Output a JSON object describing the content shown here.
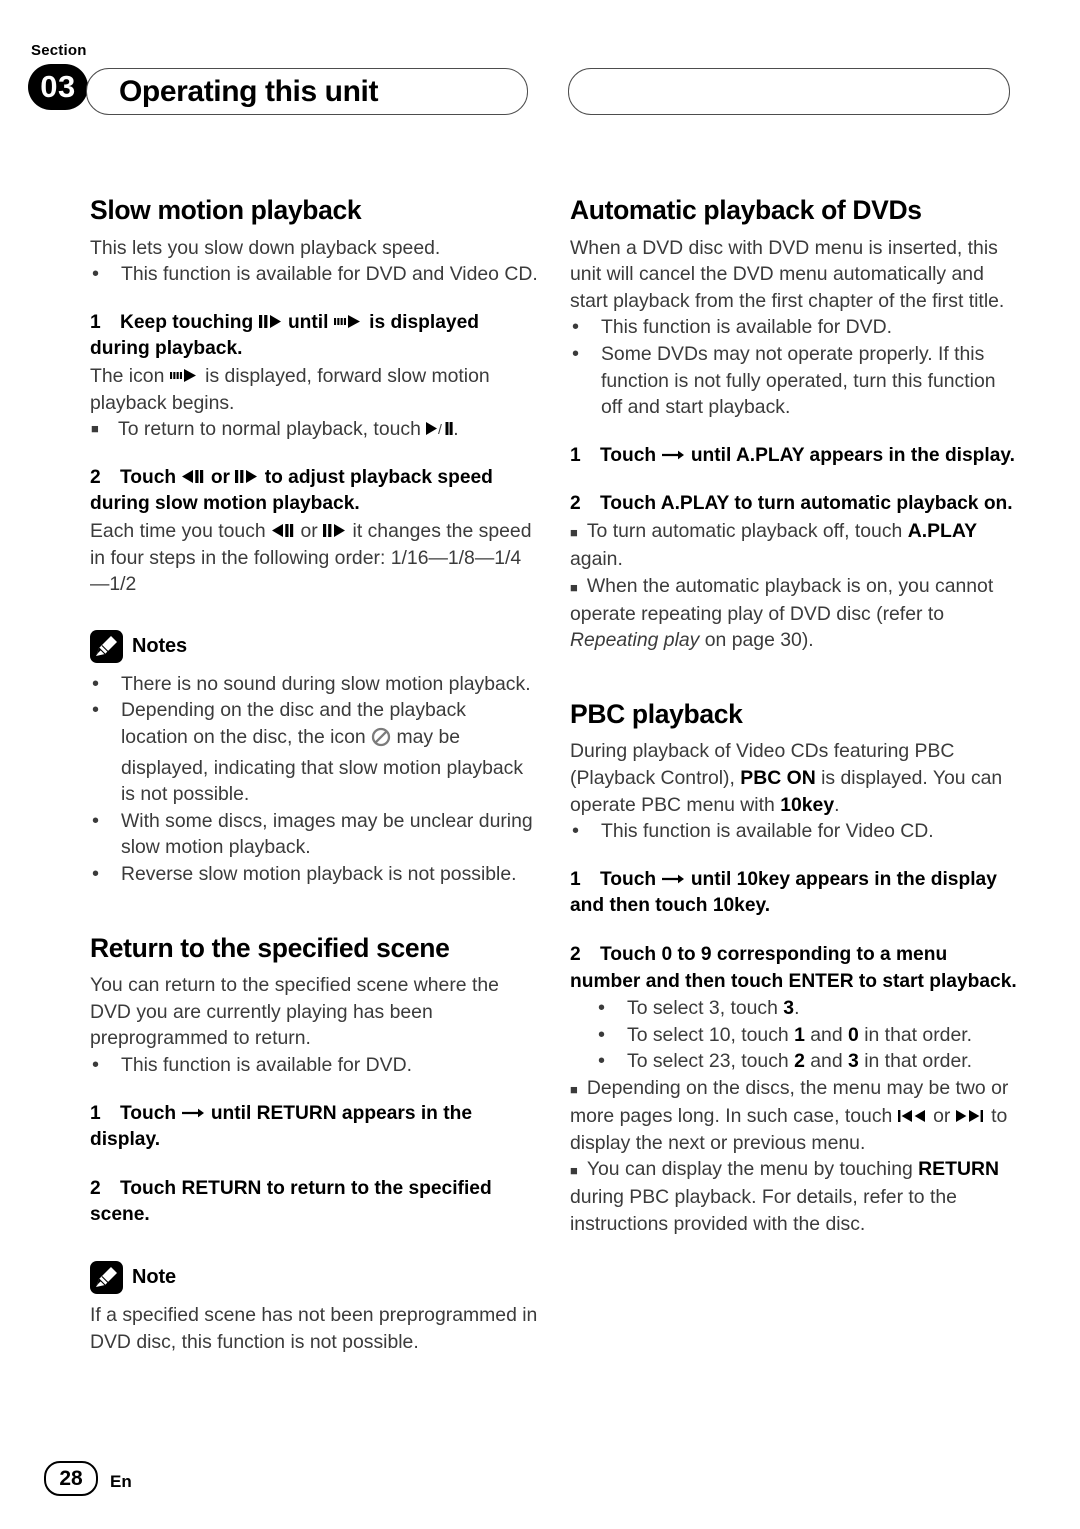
{
  "header": {
    "section_word": "Section",
    "section_number": "03",
    "title": "Operating this unit"
  },
  "footer": {
    "page_number": "28",
    "language": "En"
  },
  "left_column": {
    "section1": {
      "heading": "Slow motion playback",
      "intro": "This lets you slow down playback speed.",
      "bullets": [
        "This function is available for DVD and Video CD."
      ],
      "step1_num": "1",
      "step1_a": "Keep touching",
      "step1_b": "until",
      "step1_c": "is displayed during playback.",
      "step1_body_a": "The icon",
      "step1_body_b": "is displayed, forward slow motion playback begins.",
      "step1_sub_a": "To return to normal playback, touch",
      "step1_sub_b": ".",
      "step2_num": "2",
      "step2_a": "Touch",
      "step2_or": "or",
      "step2_c": "to adjust playback speed during slow motion playback.",
      "step2_body_a": "Each time you touch",
      "step2_body_or": "or",
      "step2_body_c": "it changes the speed in four steps in the following order:",
      "step2_body_order": "1/16—1/8—1/4—1/2",
      "notes_label": "Notes",
      "notes": [
        "There is no sound during slow motion playback.",
        "With some discs, images may be unclear during slow motion playback.",
        "Reverse slow motion playback is not possible."
      ],
      "note_icon_a": "Depending on the disc and the playback location on the disc, the icon",
      "note_icon_b": "may be displayed, indicating that slow motion playback is not possible."
    },
    "section2": {
      "heading": "Return to the specified scene",
      "intro": "You can return to the specified scene where the DVD you are currently playing has been preprogrammed to return.",
      "bullets": [
        "This function is available for DVD."
      ],
      "step1_num": "1",
      "step1_a": "Touch",
      "step1_b": "until RETURN appears in the display.",
      "step2_num": "2",
      "step2_text": "Touch RETURN to return to the specified scene.",
      "note_label": "Note",
      "note_text": "If a specified scene has not been preprogrammed in DVD disc, this function is not possible."
    }
  },
  "right_column": {
    "section1": {
      "heading": "Automatic playback of DVDs",
      "intro": "When a DVD disc with DVD menu is inserted, this unit will cancel the DVD menu automatically and start playback from the first chapter of the first title.",
      "bullets": [
        "This function is available for DVD.",
        "Some DVDs may not operate properly. If this function is not fully operated, turn this function off and start playback."
      ],
      "step1_num": "1",
      "step1_a": "Touch",
      "step1_b": "until A.PLAY appears in the display.",
      "step2_num": "2",
      "step2_text": "Touch A.PLAY to turn automatic playback on.",
      "sub1_a": "To turn automatic playback off, touch",
      "sub1_bold": "A.PLAY",
      "sub1_b": "again.",
      "sub2_a": "When the automatic playback is on, you cannot operate repeating play of DVD disc (refer to",
      "sub2_italic": "Repeating play",
      "sub2_b": "on page 30)."
    },
    "section2": {
      "heading": "PBC playback",
      "intro_a": "During playback of Video CDs featuring PBC (Playback Control),",
      "intro_bold1": "PBC ON",
      "intro_b": "is displayed. You can operate PBC menu with",
      "intro_bold2": "10key",
      "intro_c": ".",
      "bullets": [
        "This function is available for Video CD."
      ],
      "step1_num": "1",
      "step1_a": "Touch",
      "step1_b": "until 10key appears in the display and then touch 10key.",
      "step2_num": "2",
      "step2_text": "Touch 0 to 9 corresponding to a menu number and then touch ENTER to start playback.",
      "select_items": [
        {
          "a": "To select 3, touch",
          "b1": "3",
          "mid": "",
          "b2": "",
          "c": "."
        },
        {
          "a": "To select 10, touch",
          "b1": "1",
          "mid": "and",
          "b2": "0",
          "c": "in that order."
        },
        {
          "a": "To select 23, touch",
          "b1": "2",
          "mid": "and",
          "b2": "3",
          "c": "in that order."
        }
      ],
      "sub1_a": "Depending on the discs, the menu may be two or more pages long. In such case, touch",
      "sub1_or": "or",
      "sub1_b": "to display the next or previous menu.",
      "sub2_a": "You can display the menu by touching",
      "sub2_bold": "RETURN",
      "sub2_b": "during PBC playback. For details, refer to the instructions provided with the disc."
    }
  },
  "icons": {
    "pause_play": "pause-play-icon",
    "slow_forward": "slow-forward-icon",
    "play_pause": "play-pause-icon",
    "slow_reverse": "reverse-pause-icon",
    "prohibited": "prohibited-icon",
    "arrow_right": "arrow-right-icon",
    "skip_back": "skip-back-icon",
    "skip_forward": "skip-forward-icon",
    "pencil": "pencil-icon"
  }
}
